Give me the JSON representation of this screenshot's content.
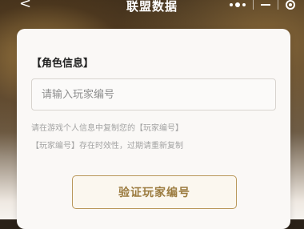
{
  "nav": {
    "back_glyph": "<",
    "title": "联盟数据"
  },
  "card": {
    "section_title": "【角色信息】",
    "input": {
      "placeholder": "请输入玩家编号",
      "value": ""
    },
    "hint_line1": "请在游戏个人信息中复制您的【玩家编号】",
    "hint_line2": "【玩家编号】存在时效性，过期请重新复制",
    "verify_button_label": "验证玩家编号"
  }
}
